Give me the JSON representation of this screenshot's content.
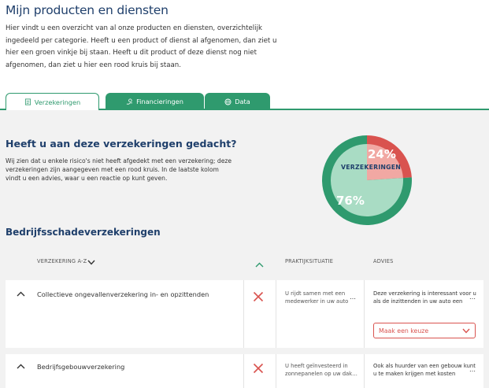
{
  "header": {
    "title": "Mijn producten en diensten",
    "intro": "Hier vindt u een overzicht van al onze producten en diensten, overzichtelijk ingedeeld per categorie. Heeft u een product of dienst al afgenomen, dan ziet u hier een groen vinkje bij staan. Heeft u dit product of deze dienst nog niet afgenomen, dan ziet u hier een rood kruis bij staan."
  },
  "tabs": [
    {
      "label": "Verzekeringen",
      "icon": "document-icon",
      "active": true
    },
    {
      "label": "Financieringen",
      "icon": "money-hand-icon",
      "active": false
    },
    {
      "label": "Data",
      "icon": "globe-icon",
      "active": false
    }
  ],
  "section": {
    "title": "Heeft u aan deze verzekeringen gedacht?",
    "text": "Wij zien dat u enkele risico's niet heeft afgedekt met een verzekering; deze verzekeringen zijn aangegeven met een rood kruis. In de laatste kolom vindt u een advies, waar u een reactie op kunt geven."
  },
  "chart_data": {
    "type": "pie",
    "title": "VERZEKERINGEN",
    "slices": [
      {
        "label": "24%",
        "value": 24,
        "color": "#d9534f"
      },
      {
        "label": "76%",
        "value": 76,
        "color": "#2f9a6e"
      }
    ]
  },
  "table": {
    "group_title": "Bedrijfsschadeverzekeringen",
    "headers": {
      "name": "VERZEKERING A-Z",
      "praktijk": "PRAKTIJKSITUATIE",
      "advies": "ADVIES"
    },
    "rows": [
      {
        "name": "Collectieve ongevallenverzekering in- en opzittenden",
        "status": "not-taken",
        "praktijk": "U rijdt samen met een medewerker in uw auto",
        "advies": "Deze verzekering is interessant voor u als de inzittenden in uw auto een",
        "select_label": "Maak een keuze"
      },
      {
        "name": "Bedrijfsgebouwverzekering",
        "status": "not-taken",
        "praktijk": "U heeft geïnvesteerd in zonnepanelen op uw dak…",
        "advies": "Ook als huurder van een gebouw kunt u te maken krijgen met kosten"
      }
    ]
  },
  "colors": {
    "primary_green": "#2f9a6e",
    "light_green": "#a9dcc4",
    "red": "#d9534f",
    "light_red": "#f1a8a3",
    "navy": "#1f3f6b"
  }
}
